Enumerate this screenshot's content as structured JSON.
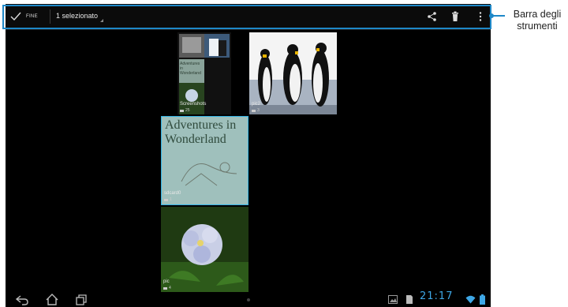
{
  "actionbar": {
    "done_label": "FINE",
    "selection_label": "1 selezionato",
    "icons": [
      "check-icon",
      "share-icon",
      "trash-icon",
      "overflow-menu-icon"
    ]
  },
  "albums": [
    {
      "name": "Screenshots",
      "count": "25"
    },
    {
      "name": "pic2",
      "count": "3"
    },
    {
      "name": "sdcard0",
      "count": "1",
      "preview_text": "Adventures in Wonderland",
      "selected": true
    },
    {
      "name": "pic",
      "count": "4"
    }
  ],
  "mini_thumb_text": "Adventures in Wonderland",
  "statusbar": {
    "time": "21:17"
  },
  "annotation": {
    "label": "Barra degli strumenti"
  },
  "colors": {
    "accent": "#1e88c8",
    "clock": "#3ea7e6",
    "selection": "#33b5e5"
  }
}
